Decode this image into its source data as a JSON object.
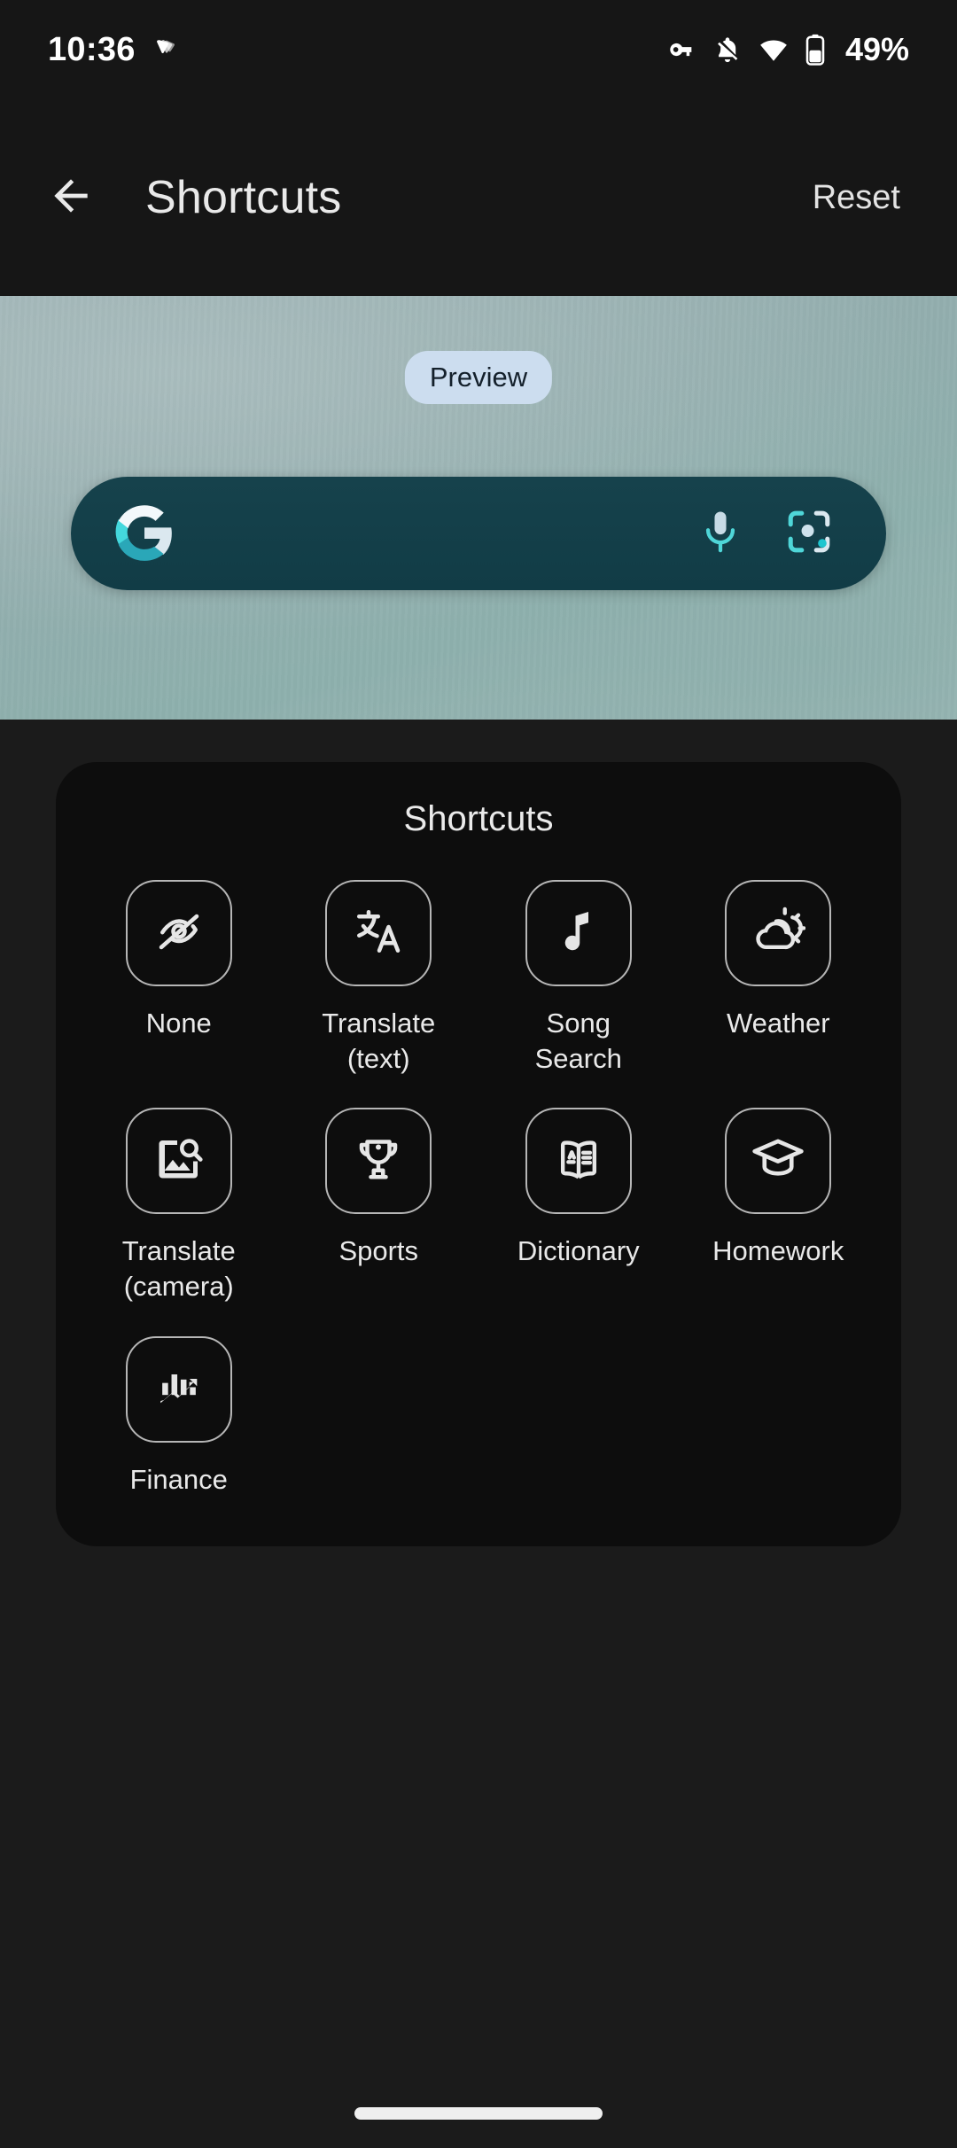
{
  "status_bar": {
    "time": "10:36",
    "notification_icon": "stack-of-cards-icon",
    "icons": [
      "vpn-key-icon",
      "ringer-muted-icon",
      "wifi-icon",
      "battery-icon"
    ],
    "battery_percent": "49%"
  },
  "app_bar": {
    "back_icon": "arrow-back-icon",
    "title": "Shortcuts",
    "reset_label": "Reset"
  },
  "preview": {
    "badge_label": "Preview",
    "search_widget": {
      "logo_icon": "google-g-icon",
      "mic_icon": "microphone-icon",
      "lens_icon": "google-lens-icon"
    }
  },
  "shortcuts_card": {
    "title": "Shortcuts",
    "items": [
      {
        "label": "None",
        "icon": "eye-off-icon"
      },
      {
        "label": "Translate\n(text)",
        "icon": "translate-text-icon"
      },
      {
        "label": "Song\nSearch",
        "icon": "music-note-icon"
      },
      {
        "label": "Weather",
        "icon": "partly-cloudy-icon"
      },
      {
        "label": "Translate\n(camera)",
        "icon": "image-search-icon"
      },
      {
        "label": "Sports",
        "icon": "trophy-icon"
      },
      {
        "label": "Dictionary",
        "icon": "open-book-icon"
      },
      {
        "label": "Homework",
        "icon": "graduation-cap-icon"
      },
      {
        "label": "Finance",
        "icon": "bar-chart-trend-icon"
      }
    ]
  },
  "navigation": {
    "home_indicator": "home-gesture-bar"
  },
  "colors": {
    "page_background": "#1b1b1b",
    "bar_background": "#161616",
    "card_background": "#0d0d0d",
    "accent_search_bar": "#113c46",
    "badge_background": "#ccddef",
    "icon_outline": "#b6b6b6",
    "text_primary": "#e9e9e9"
  }
}
